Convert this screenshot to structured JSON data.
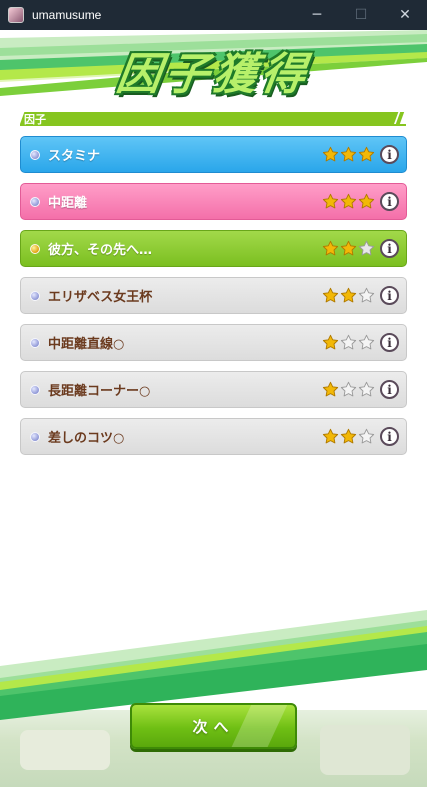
{
  "window": {
    "title": "umamusume",
    "minimize_glyph": "─",
    "maximize_glyph": "☐",
    "close_glyph": "✕"
  },
  "heading": "因子獲得",
  "section_label": "因子",
  "factors": [
    {
      "label": "スタミナ",
      "color": "blue",
      "stars": 3,
      "dot": "blue"
    },
    {
      "label": "中距離",
      "color": "pink",
      "stars": 3,
      "dot": "blue"
    },
    {
      "label": "彼方、その先へ…",
      "color": "green",
      "stars": 2,
      "dot": "gold"
    },
    {
      "label": "エリザベス女王杯",
      "color": "gray",
      "stars": 2,
      "dot": "blue"
    },
    {
      "label": "中距離直線○",
      "color": "gray",
      "stars": 1,
      "dot": "blue"
    },
    {
      "label": "長距離コーナー○",
      "color": "gray",
      "stars": 1,
      "dot": "blue"
    },
    {
      "label": "差しのコツ○",
      "color": "gray",
      "stars": 2,
      "dot": "blue"
    }
  ],
  "info_glyph": "i",
  "next_button": "次へ",
  "colors": {
    "accent_green": "#86c51f",
    "blue_row": "#2aa6ea",
    "pink_row": "#f46fa9",
    "green_row": "#7bbf20",
    "gray_row": "#dcdcdc",
    "star_gold": "#f2b807"
  },
  "icons": {
    "app": "app-icon",
    "info": "info-icon",
    "star_filled": "star-filled-icon",
    "star_empty": "star-empty-icon",
    "rank_dot": "rank-dot-icon"
  }
}
